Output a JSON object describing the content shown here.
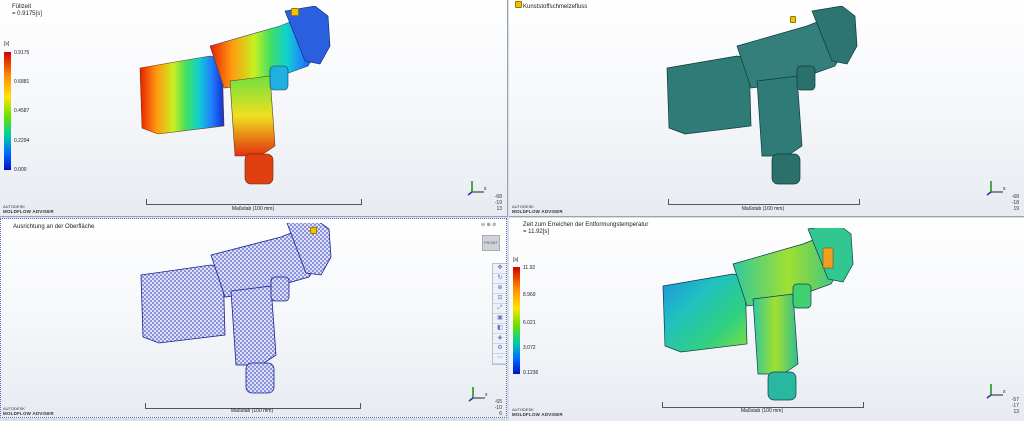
{
  "brand": {
    "line1": "AUTODESK",
    "line2": "MOLDFLOW ADVISER"
  },
  "scale_label": "Maßstab (100 mm)",
  "panes": {
    "top_left": {
      "title_line1": "Füllzeit",
      "title_line2": "= 0.9175[s]",
      "unit": "[s]",
      "legend": [
        "0.9175",
        "0.6881",
        "0.4587",
        "0.2294",
        "0.000"
      ],
      "rotation": [
        "-68",
        "-19",
        "13"
      ]
    },
    "top_right": {
      "title_line1": "Kunststoffschmelzefluss",
      "rotation": [
        "-68",
        "-18",
        "19"
      ]
    },
    "bottom_left": {
      "title_line1": "Ausrichtung an der Oberfläche",
      "rotation": [
        "-65",
        "-10",
        "6"
      ],
      "cube_label": "FRONT"
    },
    "bottom_right": {
      "title_line1": "Zeit zum Erreichen der Entformungstemperatur",
      "title_line2": "= 11.92[s]",
      "unit": "[s]",
      "legend": [
        "11.92",
        "8.969",
        "6.021",
        "3.072",
        "0.1236"
      ],
      "rotation": [
        "-57",
        "-17",
        "13"
      ]
    }
  },
  "colors": {
    "fill_gradient": [
      "#d40000",
      "#ff8a00",
      "#ffe400",
      "#66e000",
      "#00d0a0",
      "#0070ff",
      "#0010c8"
    ],
    "teal_model": "#2f7b78",
    "mesh_blue": "#3c46c8",
    "marker": "#f2c200"
  }
}
